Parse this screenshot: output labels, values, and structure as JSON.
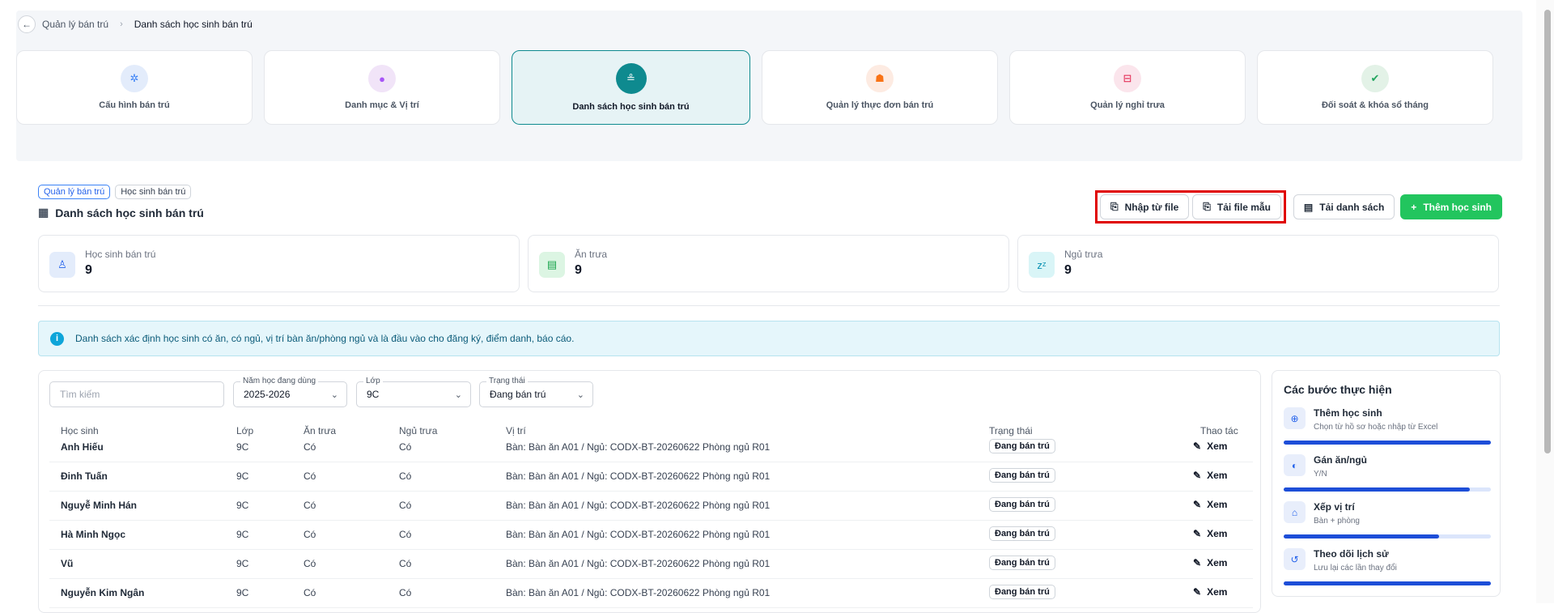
{
  "breadcrumb": {
    "parent": "Quản lý bán trú",
    "current": "Danh sách học sinh bán trú"
  },
  "nav_cards": [
    {
      "label": "Cấu hình bán trú",
      "icon": "gear-icon",
      "bg": "#e3ecfb",
      "fg": "#3b82f6",
      "active": false
    },
    {
      "label": "Danh mục & Vị trí",
      "icon": "location-pin-icon",
      "bg": "#f1e4f8",
      "fg": "#a855f7",
      "active": false
    },
    {
      "label": "Danh sách học sinh bán trú",
      "icon": "students-icon",
      "bg": "#0e8a8f",
      "fg": "#ffffff",
      "active": true
    },
    {
      "label": "Quản lý thực đơn bán trú",
      "icon": "chef-hat-icon",
      "bg": "#fdebe2",
      "fg": "#f97316",
      "active": false
    },
    {
      "label": "Quản lý nghỉ trưa",
      "icon": "bed-icon",
      "bg": "#fbe5ec",
      "fg": "#e11d48",
      "active": false
    },
    {
      "label": "Đối soát & khóa sổ tháng",
      "icon": "check-badge-icon",
      "bg": "#e3f2e7",
      "fg": "#22a55e",
      "active": false
    }
  ],
  "section": {
    "tag1": "Quản lý bán trú",
    "tag2": "Học sinh bán trú",
    "title": "Danh sách học sinh bán trú"
  },
  "toolbar": {
    "import": "Nhập từ file",
    "template": "Tải file mẫu",
    "download": "Tải danh sách",
    "add": "Thêm học sinh"
  },
  "stats": [
    {
      "label": "Học sinh bán trú",
      "value": "9",
      "icon": "student-icon",
      "bg": "#e3ecfb",
      "fg": "#2563eb"
    },
    {
      "label": "Ăn trưa",
      "value": "9",
      "icon": "meal-icon",
      "bg": "#dcf5e3",
      "fg": "#16a34a"
    },
    {
      "label": "Ngủ trưa",
      "value": "9",
      "icon": "sleep-icon",
      "bg": "#d9f5f7",
      "fg": "#0891b2"
    }
  ],
  "info": "Danh sách xác định học sinh có ăn, có ngủ, vị trí bàn ăn/phòng ngủ và là đầu vào cho đăng ký, điểm danh, báo cáo.",
  "filters": {
    "search_placeholder": "Tìm kiếm",
    "year_label": "Năm học đang dùng",
    "year_value": "2025-2026",
    "class_label": "Lớp",
    "class_value": "9C",
    "status_label": "Trạng thái",
    "status_value": "Đang bán trú"
  },
  "table": {
    "headers": [
      "Học sinh",
      "Lớp",
      "Ăn trưa",
      "Ngủ trưa",
      "Vị trí",
      "Trạng thái",
      "Thao tác"
    ],
    "rows": [
      {
        "name": "Anh Hiếu",
        "class": "9C",
        "lunch": "Có",
        "nap": "Có",
        "location": "Bàn: Bàn ăn A01 / Ngủ: CODX-BT-20260622 Phòng ngủ R01",
        "status": "Đang bán trú",
        "action": "Xem"
      },
      {
        "name": "Đinh Tuấn",
        "class": "9C",
        "lunch": "Có",
        "nap": "Có",
        "location": "Bàn: Bàn ăn A01 / Ngủ: CODX-BT-20260622 Phòng ngủ R01",
        "status": "Đang bán trú",
        "action": "Xem"
      },
      {
        "name": "Nguyễ Minh Hán",
        "class": "9C",
        "lunch": "Có",
        "nap": "Có",
        "location": "Bàn: Bàn ăn A01 / Ngủ: CODX-BT-20260622 Phòng ngủ R01",
        "status": "Đang bán trú",
        "action": "Xem"
      },
      {
        "name": "Hà Minh Ngọc",
        "class": "9C",
        "lunch": "Có",
        "nap": "Có",
        "location": "Bàn: Bàn ăn A01 / Ngủ: CODX-BT-20260622 Phòng ngủ R01",
        "status": "Đang bán trú",
        "action": "Xem"
      },
      {
        "name": "Vũ",
        "class": "9C",
        "lunch": "Có",
        "nap": "Có",
        "location": "Bàn: Bàn ăn A01 / Ngủ: CODX-BT-20260622 Phòng ngủ R01",
        "status": "Đang bán trú",
        "action": "Xem"
      },
      {
        "name": "Nguyễn Kim Ngân",
        "class": "9C",
        "lunch": "Có",
        "nap": "Có",
        "location": "Bàn: Bàn ăn A01 / Ngủ: CODX-BT-20260622 Phòng ngủ R01",
        "status": "Đang bán trú",
        "action": "Xem"
      }
    ]
  },
  "steps": {
    "title": "Các bước thực hiện",
    "items": [
      {
        "title": "Thêm học sinh",
        "desc": "Chọn từ hồ sơ hoặc nhập từ Excel",
        "icon": "add-user-icon",
        "progress": 1.0
      },
      {
        "title": "Gán ăn/ngủ",
        "desc": "Y/N",
        "icon": "toggle-icon",
        "progress": 0.9
      },
      {
        "title": "Xếp vị trí",
        "desc": "Bàn + phòng",
        "icon": "seat-icon",
        "progress": 0.75
      },
      {
        "title": "Theo dõi lịch sử",
        "desc": "Lưu lại các lần thay đổi",
        "icon": "history-icon",
        "progress": 1.0
      }
    ]
  }
}
